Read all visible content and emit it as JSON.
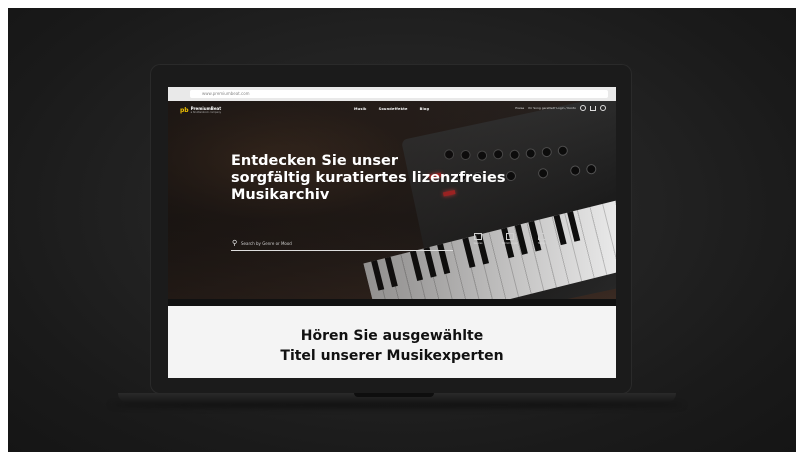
{
  "browser": {
    "url": "www.premiumbeat.com"
  },
  "site": {
    "logo_mark": "pb",
    "logo_name": "PremiumBeat",
    "logo_sub": "a Shutterstock company",
    "nav": [
      "Musik",
      "Soundeffekte",
      "Blog"
    ],
    "util_text": [
      "Preise",
      "Ihr Song gerettet? Login / Konto"
    ]
  },
  "hero": {
    "headline_lines": [
      "Entdecken Sie unser",
      "sorgfältig kuratiertes lizenzfreies",
      "Musikarchiv"
    ],
    "search_placeholder": "Search by Genre or Mood",
    "categories": [
      "Genres",
      "Stimmungen",
      "Tempo"
    ]
  },
  "section": {
    "heading_lines": [
      "Hören Sie ausgewählte",
      "Titel unserer Musikexperten"
    ]
  },
  "colors": {
    "accent": "#f2c200",
    "content_bg": "#f4f4f4",
    "backdrop": "#1a1a1a"
  }
}
